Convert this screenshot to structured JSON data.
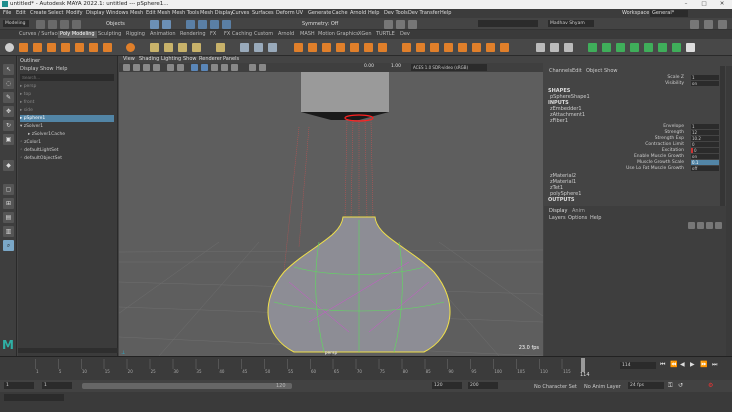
{
  "window": {
    "title": "untitled* - Autodesk MAYA 2022.1: untitled --- pSphere1..."
  },
  "menus": [
    "File",
    "Edit",
    "Create",
    "Select",
    "Modify",
    "Display",
    "Windows",
    "Mesh",
    "Edit Mesh",
    "Mesh Tools",
    "Mesh Display",
    "Curves",
    "Surfaces",
    "Deform",
    "UV",
    "Generate",
    "Cache",
    "Arnold",
    "Help",
    "Dev Tools",
    "Dev Transfer",
    "Help"
  ],
  "workspace": {
    "label": "Workspace :",
    "value": "General*"
  },
  "statusline": {
    "mode": "Modeling",
    "object": "Objects",
    "symmetry": "Symmetry: Off",
    "user": "Madhav Shyam"
  },
  "shelf_tabs": [
    "Curves / Surfaces",
    "Poly Modeling",
    "Sculpting",
    "Rigging",
    "Animation",
    "Rendering",
    "FX",
    "FX Caching",
    "Custom",
    "Arnold",
    "MASH",
    "Motion Graphics",
    "XGen",
    "TURTLE",
    "Dev"
  ],
  "outliner": {
    "title": "Outliner",
    "menus": [
      "Display",
      "Show",
      "Help"
    ],
    "search_placeholder": "Search...",
    "items": [
      "persp",
      "top",
      "front",
      "side",
      "pSphere1",
      "zSolver1",
      "zSolver1Cache",
      "zColor1",
      "defaultLightSet",
      "defaultObjectSet"
    ]
  },
  "viewport": {
    "menus": [
      "View",
      "Shading",
      "Lighting",
      "Show",
      "Renderer",
      "Panels"
    ],
    "exposure": "0.00",
    "gamma": "1.00",
    "colorspace": "ACES 1.0 SDR-video (sRGB)",
    "camera": "persp",
    "fps": "23.0 fps"
  },
  "channel_box": {
    "tabs": [
      "Channels",
      "Edit",
      "Object",
      "Show"
    ],
    "top_attrs": [
      {
        "name": "Scale Z",
        "value": "1"
      },
      {
        "name": "Visibility",
        "value": "on"
      }
    ],
    "shapes_header": "SHAPES",
    "shape": "pSphereShape1",
    "inputs_header": "INPUTS",
    "inputs": [
      "zEmbedder1",
      "zAttachment1",
      "zFiber1"
    ],
    "fiber_attrs": [
      {
        "name": "Envelope",
        "value": "1"
      },
      {
        "name": "Strength",
        "value": "12"
      },
      {
        "name": "Strength Exp",
        "value": "10.2"
      },
      {
        "name": "Contraction Limit",
        "value": "0"
      },
      {
        "name": "Excitation",
        "value": "0"
      },
      {
        "name": "Enable Muscle Growth",
        "value": "on"
      },
      {
        "name": "Muscle Growth Scale",
        "value": "0.1"
      },
      {
        "name": "Use Lo Fat Muscle Growth",
        "value": "off"
      }
    ],
    "more_inputs": [
      "zMaterial2",
      "zMaterial1",
      "zTet1",
      "polySphere1"
    ],
    "outputs_header": "OUTPUTS"
  },
  "layer_editor": {
    "tabs": [
      "Display",
      "Anim"
    ],
    "menus": [
      "Layers",
      "Options",
      "Help"
    ]
  },
  "timeline": {
    "ticks": [
      "1",
      "5",
      "10",
      "15",
      "20",
      "25",
      "30",
      "35",
      "40",
      "45",
      "50",
      "55",
      "60",
      "65",
      "70",
      "75",
      "80",
      "85",
      "90",
      "95",
      "100",
      "105",
      "110",
      "115"
    ],
    "current": "114",
    "current_field": "114"
  },
  "range": {
    "start": "1",
    "start2": "1",
    "slider_val": "120",
    "end1": "120",
    "end2": "200",
    "fps": "24 fps",
    "char_set": "No Character Set",
    "anim_layer": "No Anim Layer"
  },
  "colors": {
    "accent": "#5285a6",
    "select_yellow": "#f0e04a",
    "edge_green": "#5ddc5d",
    "muscle_red": "#ff2020"
  }
}
